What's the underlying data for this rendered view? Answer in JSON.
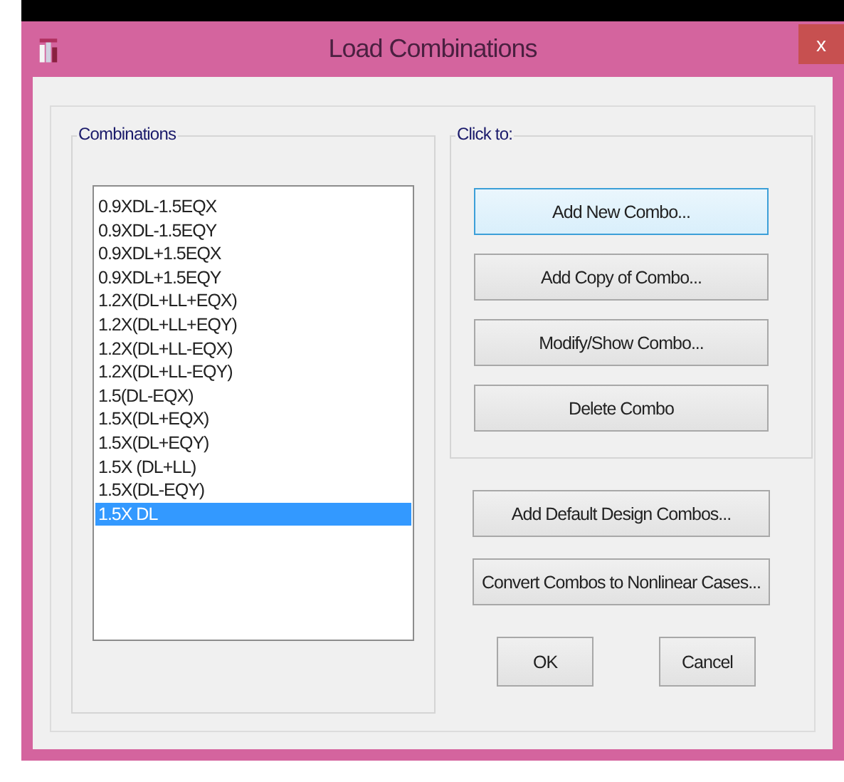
{
  "window": {
    "title": "Load Combinations",
    "close": "x"
  },
  "combinations": {
    "label": "Combinations",
    "items": [
      {
        "text": "0.9XDL-1.5EQX",
        "selected": false
      },
      {
        "text": "0.9XDL-1.5EQY",
        "selected": false
      },
      {
        "text": "0.9XDL+1.5EQX",
        "selected": false
      },
      {
        "text": "0.9XDL+1.5EQY",
        "selected": false
      },
      {
        "text": "1.2X(DL+LL+EQX)",
        "selected": false
      },
      {
        "text": "1.2X(DL+LL+EQY)",
        "selected": false
      },
      {
        "text": "1.2X(DL+LL-EQX)",
        "selected": false
      },
      {
        "text": "1.2X(DL+LL-EQY)",
        "selected": false
      },
      {
        "text": "1.5(DL-EQX)",
        "selected": false
      },
      {
        "text": "1.5X(DL+EQX)",
        "selected": false
      },
      {
        "text": "1.5X(DL+EQY)",
        "selected": false
      },
      {
        "text": "1.5X (DL+LL)",
        "selected": false
      },
      {
        "text": "1.5X(DL-EQY)",
        "selected": false
      },
      {
        "text": "1.5X DL",
        "selected": true
      }
    ]
  },
  "click_to": {
    "label": "Click to:",
    "buttons": [
      {
        "label": "Add New Combo...",
        "focused": true
      },
      {
        "label": "Add Copy of Combo...",
        "focused": false
      },
      {
        "label": "Modify/Show Combo...",
        "focused": false
      },
      {
        "label": "Delete Combo",
        "focused": false
      }
    ]
  },
  "extra_buttons": [
    "Add Default Design Combos...",
    "Convert Combos to Nonlinear Cases..."
  ],
  "dialog_buttons": [
    "OK",
    "Cancel"
  ]
}
